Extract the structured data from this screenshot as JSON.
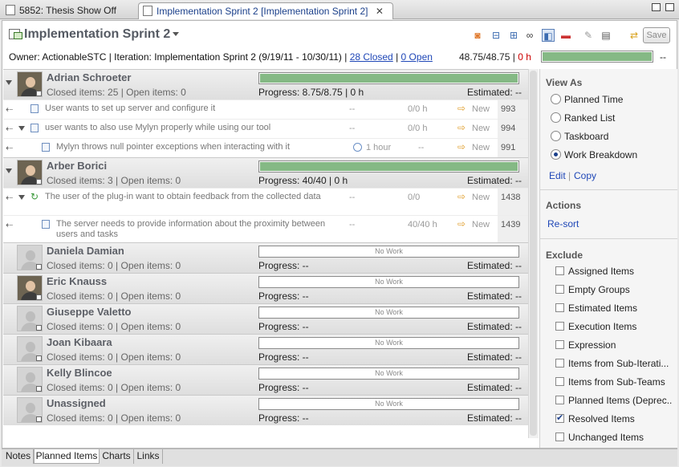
{
  "tabs": [
    {
      "label": "5852: Thesis Show Off",
      "active": false
    },
    {
      "label": "Implementation Sprint 2 [Implementation Sprint 2]",
      "active": true
    }
  ],
  "header": {
    "title": "Implementation Sprint 2",
    "owner_text": "Owner: ActionableSTC | Iteration: Implementation Sprint 2 (9/19/11 - 10/30/11) |",
    "closed_link": "28 Closed",
    "sep": "|",
    "open_link": "0 Open",
    "total_prefix": "48.75/48.75 |",
    "total_zero": "0 h",
    "progress": 1.0,
    "trail": "--",
    "save_label": "Save"
  },
  "groups": [
    {
      "name": "Adrian Schroeter",
      "sub": "Closed items: 25 | Open items: 0",
      "progress_text": "Progress: 8.75/8.75 | 0 h",
      "estimated": "Estimated: --",
      "fill": 1.0,
      "bar_label": "",
      "expanded": true,
      "photo": true,
      "items": [
        {
          "summary": "User wants to set up server and configure it",
          "col1": "--",
          "col2": "0/0 h",
          "status": "New",
          "id": "993",
          "depth": 0
        },
        {
          "summary": "user wants to also use Mylyn properly while using our tool",
          "col1": "--",
          "col2": "0/0 h",
          "status": "New",
          "id": "994",
          "depth": 0,
          "twist": true
        },
        {
          "summary": "Mylyn throws null pointer exceptions when interacting with it",
          "col1": "1 hour",
          "col2": "--",
          "status": "New",
          "id": "991",
          "depth": 1,
          "clock": true
        }
      ]
    },
    {
      "name": "Arber Borici",
      "sub": "Closed items: 3 | Open items: 0",
      "progress_text": "Progress: 40/40 | 0 h",
      "estimated": "Estimated: --",
      "fill": 1.0,
      "bar_label": "",
      "expanded": true,
      "photo": true,
      "items": [
        {
          "summary": "The user of the plug-in want to obtain feedback from the collected data",
          "col1": "--",
          "col2": "0/0",
          "status": "New",
          "id": "1438",
          "depth": 0,
          "twist": true,
          "sync": true
        },
        {
          "summary": "The server needs to provide information about the proximity between users and tasks",
          "col1": "--",
          "col2": "40/40 h",
          "status": "New",
          "id": "1439",
          "depth": 1
        }
      ]
    },
    {
      "name": "Daniela Damian",
      "sub": "Closed items: 0 | Open items: 0",
      "progress_text": "Progress: --",
      "estimated": "Estimated: --",
      "fill": 0,
      "bar_label": "No Work",
      "photo": false
    },
    {
      "name": "Eric Knauss",
      "sub": "Closed items: 0 | Open items: 0",
      "progress_text": "Progress: --",
      "estimated": "Estimated: --",
      "fill": 0,
      "bar_label": "No Work",
      "photo": true
    },
    {
      "name": "Giuseppe Valetto",
      "sub": "Closed items: 0 | Open items: 0",
      "progress_text": "Progress: --",
      "estimated": "Estimated: --",
      "fill": 0,
      "bar_label": "No Work",
      "photo": false
    },
    {
      "name": "Joan Kibaara",
      "sub": "Closed items: 0 | Open items: 0",
      "progress_text": "Progress: --",
      "estimated": "Estimated: --",
      "fill": 0,
      "bar_label": "No Work",
      "photo": false
    },
    {
      "name": "Kelly Blincoe",
      "sub": "Closed items: 0 | Open items: 0",
      "progress_text": "Progress: --",
      "estimated": "Estimated: --",
      "fill": 0,
      "bar_label": "No Work",
      "photo": false
    },
    {
      "name": "Unassigned",
      "sub": "Closed items: 0 | Open items: 0",
      "progress_text": "Progress: --",
      "estimated": "Estimated: --",
      "fill": 0,
      "bar_label": "No Work",
      "photo": false
    }
  ],
  "right": {
    "view_as_title": "View As",
    "view_options": [
      {
        "label": "Planned Time",
        "selected": false
      },
      {
        "label": "Ranked List",
        "selected": false
      },
      {
        "label": "Taskboard",
        "selected": false
      },
      {
        "label": "Work Breakdown",
        "selected": true
      }
    ],
    "edit": "Edit",
    "sep": "|",
    "copy": "Copy",
    "actions_title": "Actions",
    "resort": "Re-sort",
    "exclude_title": "Exclude",
    "exclude_options": [
      {
        "label": "Assigned Items",
        "checked": false
      },
      {
        "label": "Empty Groups",
        "checked": false
      },
      {
        "label": "Estimated Items",
        "checked": false
      },
      {
        "label": "Execution Items",
        "checked": false
      },
      {
        "label": "Expression",
        "checked": false
      },
      {
        "label": "Items from Sub-Iterati...",
        "checked": false
      },
      {
        "label": "Items from Sub-Teams",
        "checked": false
      },
      {
        "label": "Planned Items (Deprec...",
        "checked": false
      },
      {
        "label": "Resolved Items",
        "checked": true
      },
      {
        "label": "Unchanged Items",
        "checked": false
      }
    ]
  },
  "bottom_tabs": [
    {
      "label": "Notes",
      "active": false
    },
    {
      "label": "Planned Items",
      "active": true
    },
    {
      "label": "Charts",
      "active": false
    },
    {
      "label": "Links",
      "active": false
    }
  ]
}
